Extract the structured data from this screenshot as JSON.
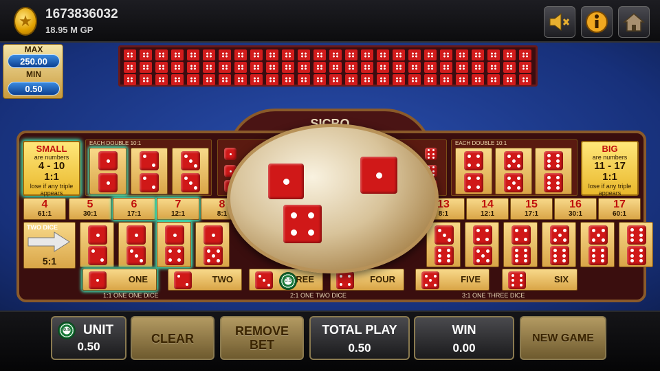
{
  "header": {
    "account_id": "1673836032",
    "balance": "18.95 M GP",
    "coin_icon": "star-coin-icon",
    "buttons": [
      {
        "name": "mute-button",
        "icon": "speaker-muted-icon"
      },
      {
        "name": "info-button",
        "icon": "info-icon"
      },
      {
        "name": "home-button",
        "icon": "home-icon"
      }
    ]
  },
  "limits": {
    "max_label": "MAX",
    "max_value": "250.00",
    "min_label": "MIN",
    "min_value": "0.50"
  },
  "board": {
    "small": {
      "title": "SMALL",
      "line1": "are numbers",
      "range": "4 - 10",
      "payout": "1:1",
      "note": "lose if any triple appears"
    },
    "big": {
      "title": "BIG",
      "line1": "are numbers",
      "range": "11 - 17",
      "payout": "1:1",
      "note": "lose if any triple appears"
    },
    "each_double_left": "EACH DOUBLE 10:1",
    "each_double_right": "EACH DOUBLE 10:1",
    "arch_title": "SICBO",
    "totals": [
      {
        "n": "4",
        "odds": "61:1"
      },
      {
        "n": "5",
        "odds": "30:1"
      },
      {
        "n": "6",
        "odds": "17:1"
      },
      {
        "n": "7",
        "odds": "12:1"
      },
      {
        "n": "8",
        "odds": "8:1"
      },
      {
        "n": "13",
        "odds": "8:1"
      },
      {
        "n": "14",
        "odds": "12:1"
      },
      {
        "n": "15",
        "odds": "17:1"
      },
      {
        "n": "16",
        "odds": "30:1"
      },
      {
        "n": "17",
        "odds": "60:1"
      }
    ],
    "two_dice_label": "TWO DICE",
    "two_dice_odds": "5:1",
    "singles": [
      "ONE",
      "TWO",
      "THREE",
      "FOUR",
      "FIVE",
      "SIX"
    ],
    "captions": [
      "1:1 ONE ONE DICE",
      "2:1 ONE TWO DICE",
      "3:1 ONE THREE DICE"
    ],
    "chip_on_board": "0.5",
    "result_dice": [
      1,
      1,
      4
    ]
  },
  "bottom": {
    "unit_label": "UNIT",
    "unit_value": "0.50",
    "chip_value": "0.5",
    "clear_label": "CLEAR",
    "remove_label_1": "REMOVE",
    "remove_label_2": "BET",
    "total_label": "TOTAL PLAY",
    "total_value": "0.50",
    "win_label": "WIN",
    "win_value": "0.00",
    "new_game_label": "NEW GAME"
  },
  "colors": {
    "felt": "#1d3a8c",
    "die": "#d01818",
    "gold": "#d9a547"
  }
}
